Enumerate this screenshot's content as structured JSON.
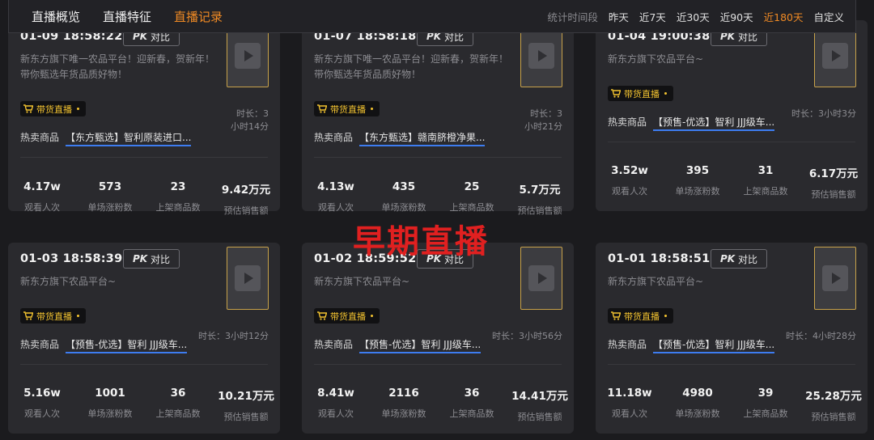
{
  "tabs": [
    "直播概览",
    "直播特征",
    "直播记录"
  ],
  "range": {
    "label": "统计时间段",
    "items": [
      "昨天",
      "近7天",
      "近30天",
      "近90天",
      "近180天",
      "自定义"
    ]
  },
  "accent": "#f08a24",
  "overlay": "早期直播",
  "stat_labels": [
    "观看人次",
    "单场涨粉数",
    "上架商品数",
    "预估销售额"
  ],
  "pk_label": "对比",
  "pk_prefix": "PK",
  "tag_label": "带货直播",
  "hot_label": "热卖商品",
  "cards": [
    {
      "time": "01-09 18:58:22",
      "desc": "新东方旗下唯一农品平台！迎新春，贺新年！带你甄选年货品质好物！",
      "duration": "时长：3小时14分",
      "product": "【东方甄选】智利原装进口...",
      "stats": [
        "4.17w",
        "573",
        "23",
        "9.42万元"
      ]
    },
    {
      "time": "01-07 18:58:18",
      "desc": "新东方旗下唯一农品平台！迎新春，贺新年！带你甄选年货品质好物！",
      "duration": "时长：3小时21分",
      "product": "【东方甄选】赣南脐橙净果...",
      "stats": [
        "4.13w",
        "435",
        "25",
        "5.7万元"
      ]
    },
    {
      "time": "01-04 19:00:38",
      "desc": "新东方旗下农品平台~",
      "duration": "时长：3小时3分",
      "product": "【预售-优选】智利 JJJ级车...",
      "stats": [
        "3.52w",
        "395",
        "31",
        "6.17万元"
      ]
    },
    {
      "time": "01-03 18:58:39",
      "desc": "新东方旗下农品平台~",
      "duration": "时长：3小时12分",
      "product": "【预售-优选】智利 JJJ级车...",
      "stats": [
        "5.16w",
        "1001",
        "36",
        "10.21万元"
      ]
    },
    {
      "time": "01-02 18:59:52",
      "desc": "新东方旗下农品平台~",
      "duration": "时长：3小时56分",
      "product": "【预售-优选】智利 JJJ级车...",
      "stats": [
        "8.41w",
        "2116",
        "36",
        "14.41万元"
      ]
    },
    {
      "time": "01-01 18:58:51",
      "desc": "新东方旗下农品平台~",
      "duration": "时长：4小时28分",
      "product": "【预售-优选】智利 JJJ级车...",
      "stats": [
        "11.18w",
        "4980",
        "39",
        "25.28万元"
      ]
    }
  ]
}
